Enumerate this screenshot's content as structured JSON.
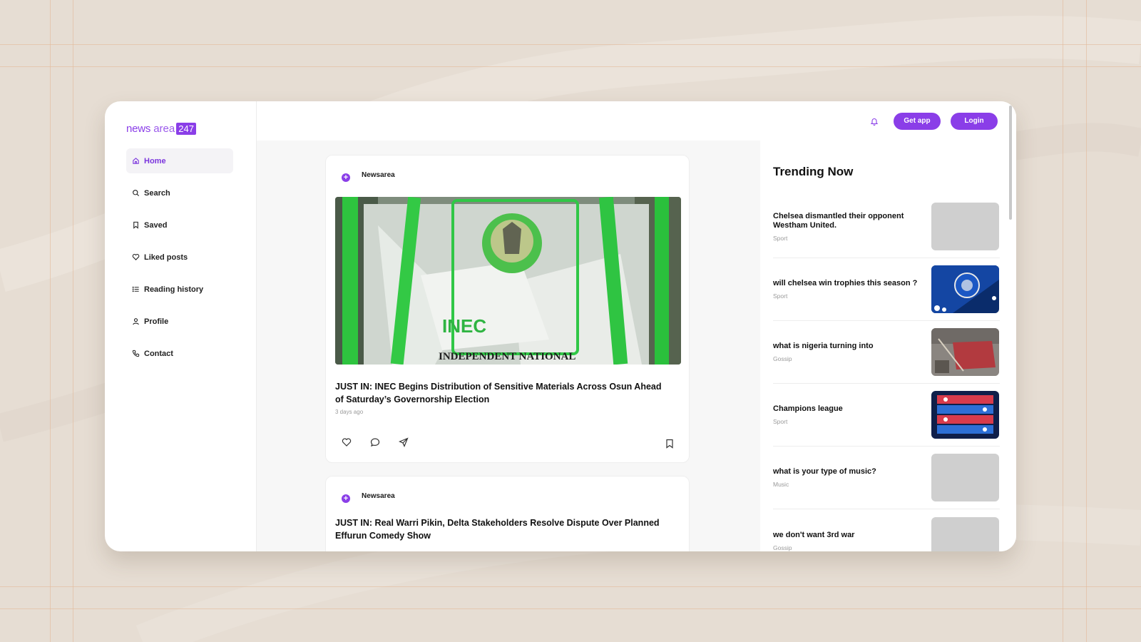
{
  "logo": {
    "brand_part1": "news",
    "brand_part2": "area",
    "brand_badge": "247"
  },
  "sidebar": {
    "items": [
      {
        "label": "Home",
        "icon": "home-icon",
        "active": true
      },
      {
        "label": "Search",
        "icon": "search-icon",
        "active": false
      },
      {
        "label": "Saved",
        "icon": "bookmark-icon",
        "active": false
      },
      {
        "label": "Liked posts",
        "icon": "heart-icon",
        "active": false
      },
      {
        "label": "Reading history",
        "icon": "list-icon",
        "active": false
      },
      {
        "label": "Profile",
        "icon": "user-icon",
        "active": false
      },
      {
        "label": "Contact",
        "icon": "phone-icon",
        "active": false
      }
    ]
  },
  "topbar": {
    "get_app_label": "Get app",
    "login_label": "Login",
    "bell_icon": "bell-icon"
  },
  "feed": {
    "posts": [
      {
        "author": "Newsarea",
        "title": "JUST IN: INEC Begins Distribution of Sensitive Materials Across Osun Ahead of Saturday’s Governorship Election",
        "time": "3 days ago",
        "image_caption": "INDEPENDENT NATIONAL"
      },
      {
        "author": "Newsarea",
        "title": "JUST IN: Real Warri Pikin, Delta Stakeholders Resolve Dispute Over Planned Effurun Comedy Show"
      }
    ]
  },
  "trending": {
    "title": "Trending Now",
    "items": [
      {
        "headline": "Chelsea dismantled their opponent Westham United.",
        "category": "Sport",
        "thumb": "placeholder"
      },
      {
        "headline": "will chelsea win trophies this season ?",
        "category": "Sport",
        "thumb": "chelsea-flag"
      },
      {
        "headline": "what is nigeria turning into",
        "category": "Gossip",
        "thumb": "street-scene"
      },
      {
        "headline": "Champions league",
        "category": "Sport",
        "thumb": "champions-graphic"
      },
      {
        "headline": "what is your type of music?",
        "category": "Music",
        "thumb": "placeholder"
      },
      {
        "headline": "we don't want 3rd war",
        "category": "Gossip",
        "thumb": "placeholder"
      }
    ]
  },
  "colors": {
    "accent": "#8a3ee8",
    "background": "#e6ddd3",
    "card": "#ffffff",
    "feed_bg": "#f7f7f7"
  }
}
